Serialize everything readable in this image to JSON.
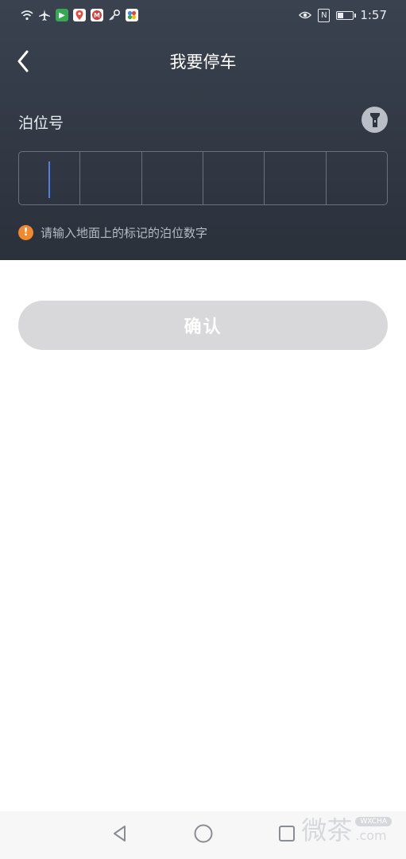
{
  "status_bar": {
    "time": "1:57",
    "nfc_label": "N",
    "battery_level": 0.35,
    "left_icons": [
      "wifi-icon",
      "airplane-icon",
      "play-store-icon",
      "map-pin-app-icon",
      "metro-app-icon",
      "key-icon",
      "photos-app-icon"
    ],
    "right_icons": [
      "eye-icon",
      "nfc-icon",
      "battery-icon"
    ]
  },
  "header": {
    "title": "我要停车",
    "back_icon": "chevron-left-icon",
    "berth_label": "泊位号",
    "flashlight_icon": "flashlight-icon",
    "hint_text": "请输入地面上的标记的泊位数字"
  },
  "berth_input": {
    "cell_count": 6,
    "digits": [
      "",
      "",
      "",
      "",
      "",
      ""
    ],
    "active_index": 0
  },
  "confirm_button": {
    "label": "确认"
  },
  "nav_bar": {
    "icons": [
      "back-triangle-icon",
      "home-circle-icon",
      "recents-square-icon"
    ]
  },
  "watermark": {
    "text": "微茶",
    "badge": "WXCHA",
    "suffix": ".com"
  },
  "colors": {
    "header_bg": "#2f3540",
    "accent_caret": "#4e7fe8",
    "hint_icon": "#f08a2e",
    "button_disabled": "#d8d8da"
  }
}
